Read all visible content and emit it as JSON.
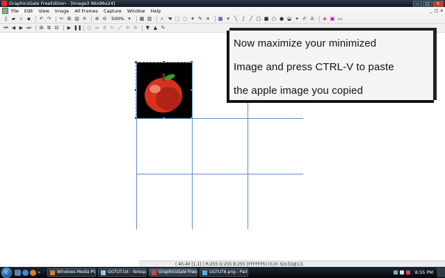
{
  "window": {
    "title": "GraphicsGale FreeEdition - [Image3 96x96x24]",
    "controls": [
      "–",
      "□",
      "✕"
    ]
  },
  "menu": {
    "items": [
      "File",
      "Edit",
      "View",
      "Image",
      "All Frames",
      "Capture",
      "Window",
      "Help"
    ],
    "mdi_controls": [
      "_",
      "□",
      "x"
    ]
  },
  "toolbar": {
    "zoom_label": "500%"
  },
  "instruction": {
    "lines": [
      "Now maximize your minimized",
      "Image and press CTRL-V to paste",
      "the apple image you copied"
    ]
  },
  "statusbar": {
    "text": "( 40,40 [1,1] )  R:255 G:255 B:255  [FFFFFFh]  (0,0) 32x32@1/1"
  },
  "taskbar": {
    "tasks": [
      {
        "label": "Windows Media Pla...",
        "active": false
      },
      {
        "label": "GGTUT.txt - Notepad",
        "active": false
      },
      {
        "label": "GraphicsGale FreeEd...",
        "active": true
      },
      {
        "label": "GGTUT8.png - Paint",
        "active": false
      }
    ],
    "clock": "8:55 PM"
  },
  "colors": {
    "grid": "#5a8ad0",
    "apple_body": "#d8321e",
    "apple_highlight": "#f08070",
    "leaf": "#3a9a2a"
  }
}
